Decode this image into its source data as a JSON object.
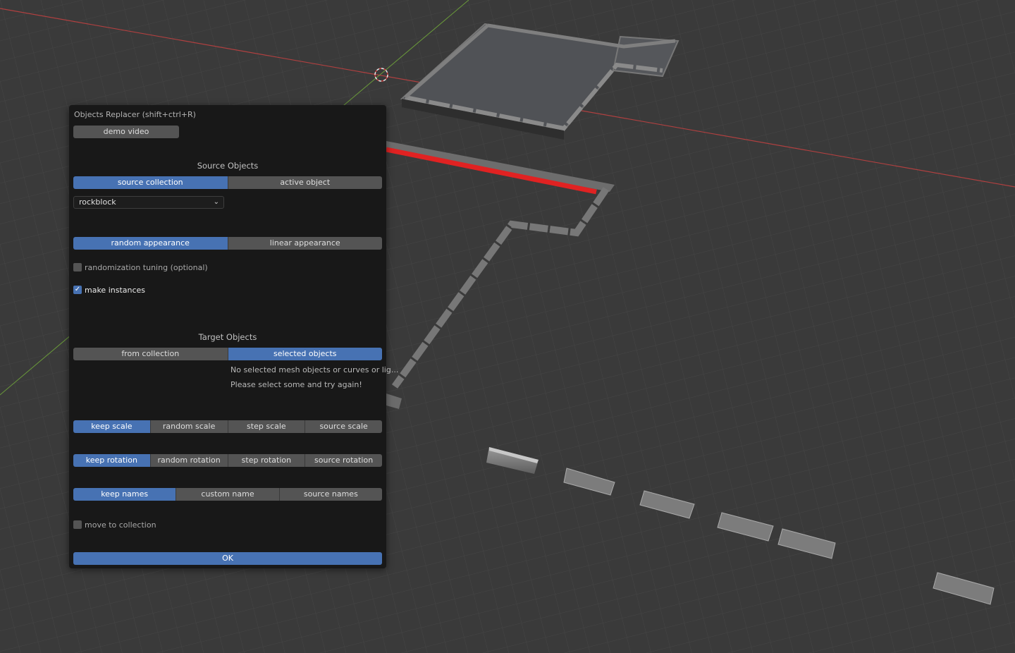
{
  "colors": {
    "accent": "#4772b3",
    "panel_bg": "#181818",
    "button_bg": "#545454",
    "viewport_bg": "#3a3a3a",
    "x_axis": "#c83232",
    "y_axis": "#6a9a3a"
  },
  "dialog": {
    "title": "Objects Replacer  (shift+ctrl+R)",
    "demo_button": "demo video",
    "source": {
      "heading": "Source Objects",
      "options": [
        "source collection",
        "active object"
      ],
      "active_index": 0,
      "collection_value": "rockblock",
      "appearance_options": [
        "random appearance",
        "linear appearance"
      ],
      "appearance_active": 0,
      "randomization_label": "randomization tuning (optional)",
      "randomization_checked": false,
      "instances_label": "make instances",
      "instances_checked": true
    },
    "target": {
      "heading": "Target Objects",
      "options": [
        "from collection",
        "selected objects"
      ],
      "active_index": 1,
      "message_line1": "No selected mesh objects or curves or lig...",
      "message_line2": "Please select some and try again!"
    },
    "scale_options": [
      "keep scale",
      "random scale",
      "step scale",
      "source scale"
    ],
    "scale_active": 0,
    "rotation_options": [
      "keep rotation",
      "random rotation",
      "step rotation",
      "source rotation"
    ],
    "rotation_active": 0,
    "names_options": [
      "keep names",
      "custom name",
      "source names"
    ],
    "names_active": 0,
    "move_label": "move to collection",
    "move_checked": false,
    "ok_label": "OK"
  },
  "icons": {
    "dropdown": "chevron-down-icon",
    "check": "checkmark-icon",
    "cursor": "3d-cursor-icon"
  }
}
